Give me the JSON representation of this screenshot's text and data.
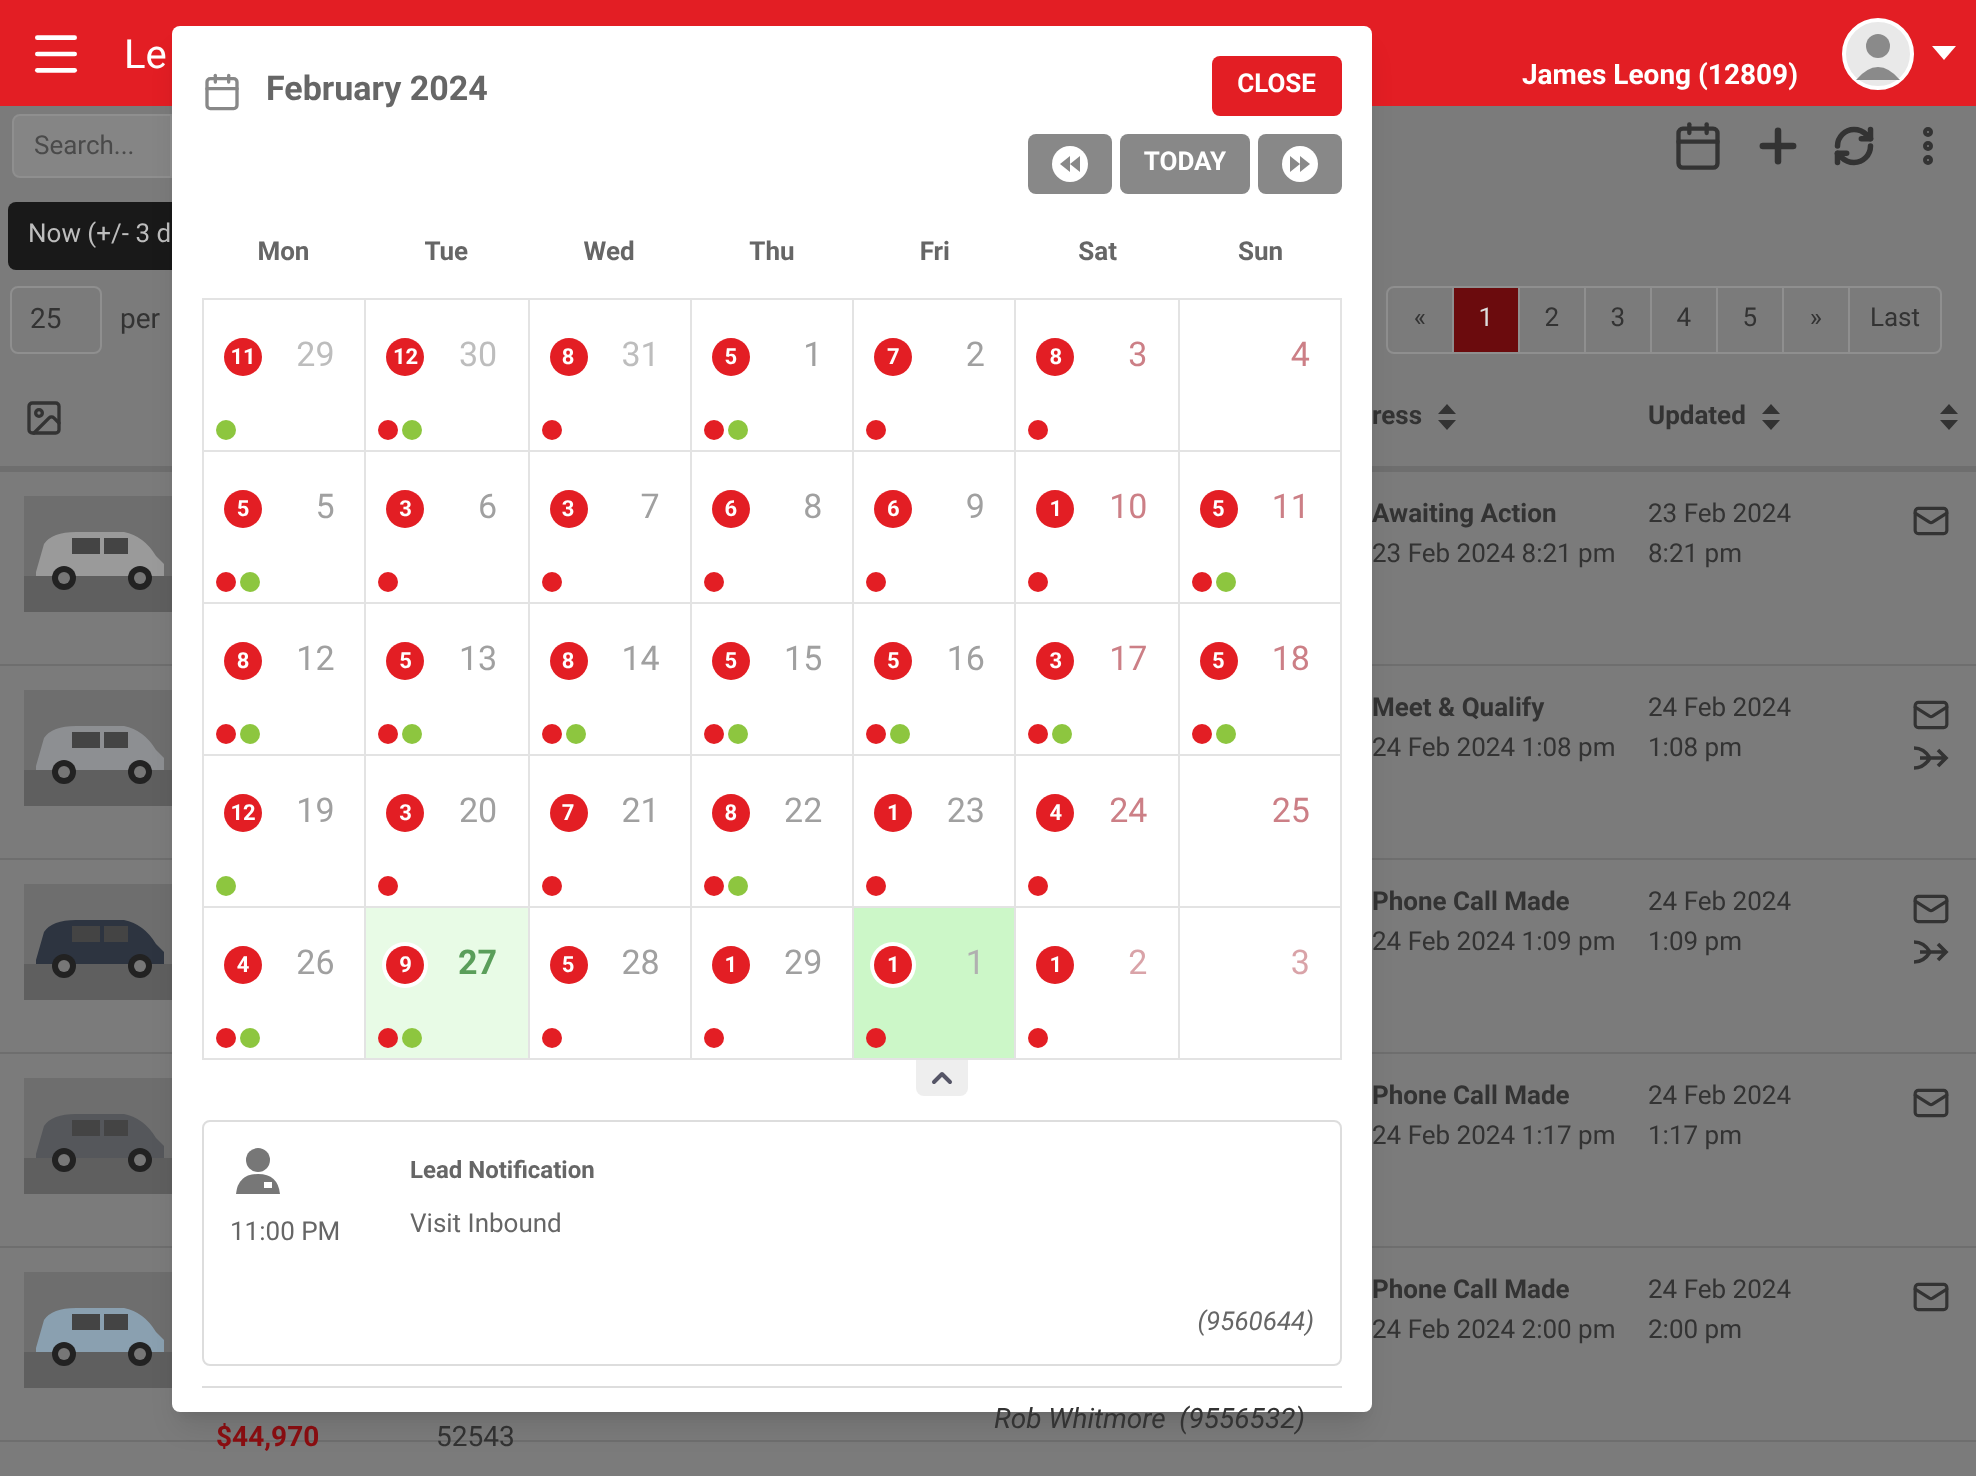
{
  "app": {
    "title": "Le",
    "user": "James Leong (12809)"
  },
  "search": {
    "placeholder": "Search..."
  },
  "filter_button": "Now (+/- 3 d",
  "page_size": {
    "value": "25",
    "label": "per"
  },
  "pagination": [
    {
      "label": "«",
      "selected": false
    },
    {
      "label": "1",
      "selected": true
    },
    {
      "label": "2",
      "selected": false
    },
    {
      "label": "3",
      "selected": false
    },
    {
      "label": "4",
      "selected": false
    },
    {
      "label": "5",
      "selected": false
    },
    {
      "label": "»",
      "selected": false
    },
    {
      "label": "Last",
      "selected": false
    }
  ],
  "table": {
    "columns": [
      "ress",
      "Updated"
    ],
    "rows": [
      {
        "status": "Awaiting Action",
        "status_time": "23 Feb 2024 8:21 pm",
        "updated_date": "23 Feb 2024",
        "updated_time": "8:21 pm",
        "actions": [
          {
            "kind": "mail"
          }
        ]
      },
      {
        "status": "Meet & Qualify",
        "status_time": "24 Feb 2024 1:08 pm",
        "updated_date": "24 Feb 2024",
        "updated_time": "1:08 pm",
        "actions": [
          {
            "kind": "mail"
          },
          {
            "kind": "transfer"
          }
        ]
      },
      {
        "status": "Phone Call Made",
        "status_time": "24 Feb 2024 1:09 pm",
        "updated_date": "24 Feb 2024",
        "updated_time": "1:09 pm",
        "actions": [
          {
            "kind": "mail"
          },
          {
            "kind": "transfer"
          }
        ]
      },
      {
        "status": "Phone Call Made",
        "status_time": "24 Feb 2024 1:17 pm",
        "updated_date": "24 Feb 2024",
        "updated_time": "1:17 pm",
        "actions": [
          {
            "kind": "mail"
          }
        ]
      },
      {
        "status": "Phone Call Made",
        "status_time": "24 Feb 2024 2:00 pm",
        "updated_date": "24 Feb 2024",
        "updated_time": "2:00 pm",
        "actions": [
          {
            "kind": "mail"
          }
        ]
      }
    ],
    "footer": {
      "price": "$44,970",
      "stock": "52543",
      "salesperson": "Rob Whitmore  (9556532)"
    }
  },
  "calendar": {
    "title": "February 2024",
    "close": "CLOSE",
    "today_button": "TODAY",
    "weekdays": [
      "Mon",
      "Tue",
      "Wed",
      "Thu",
      "Fri",
      "Sat",
      "Sun"
    ],
    "weeks": [
      [
        {
          "day": "29",
          "count": "11",
          "kind": "prev",
          "today": false,
          "selected": false,
          "dots": [
            {
              "color": "#8dc63f"
            }
          ]
        },
        {
          "day": "30",
          "count": "12",
          "kind": "prev",
          "today": false,
          "selected": false,
          "dots": [
            {
              "color": "#e31e24"
            },
            {
              "color": "#8dc63f"
            }
          ]
        },
        {
          "day": "31",
          "count": "8",
          "kind": "prev",
          "today": false,
          "selected": false,
          "dots": [
            {
              "color": "#e31e24"
            }
          ]
        },
        {
          "day": "1",
          "count": "5",
          "kind": "current",
          "today": false,
          "selected": false,
          "dots": [
            {
              "color": "#e31e24"
            },
            {
              "color": "#8dc63f"
            }
          ]
        },
        {
          "day": "2",
          "count": "7",
          "kind": "current",
          "today": false,
          "selected": false,
          "dots": [
            {
              "color": "#e31e24"
            }
          ]
        },
        {
          "day": "3",
          "count": "8",
          "kind": "current",
          "today": false,
          "selected": false,
          "dots": [
            {
              "color": "#e31e24"
            }
          ]
        },
        {
          "day": "4",
          "kind": "current",
          "today": false,
          "selected": false
        }
      ],
      [
        {
          "day": "5",
          "count": "5",
          "kind": "current",
          "today": false,
          "selected": false,
          "dots": [
            {
              "color": "#e31e24"
            },
            {
              "color": "#8dc63f"
            }
          ]
        },
        {
          "day": "6",
          "count": "3",
          "kind": "current",
          "today": false,
          "selected": false,
          "dots": [
            {
              "color": "#e31e24"
            }
          ]
        },
        {
          "day": "7",
          "count": "3",
          "kind": "current",
          "today": false,
          "selected": false,
          "dots": [
            {
              "color": "#e31e24"
            }
          ]
        },
        {
          "day": "8",
          "count": "6",
          "kind": "current",
          "today": false,
          "selected": false,
          "dots": [
            {
              "color": "#e31e24"
            }
          ]
        },
        {
          "day": "9",
          "count": "6",
          "kind": "current",
          "today": false,
          "selected": false,
          "dots": [
            {
              "color": "#e31e24"
            }
          ]
        },
        {
          "day": "10",
          "count": "1",
          "kind": "current",
          "today": false,
          "selected": false,
          "dots": [
            {
              "color": "#e31e24"
            }
          ]
        },
        {
          "day": "11",
          "count": "5",
          "kind": "current",
          "today": false,
          "selected": false,
          "dots": [
            {
              "color": "#e31e24"
            },
            {
              "color": "#8dc63f"
            }
          ]
        }
      ],
      [
        {
          "day": "12",
          "count": "8",
          "kind": "current",
          "today": false,
          "selected": false,
          "dots": [
            {
              "color": "#e31e24"
            },
            {
              "color": "#8dc63f"
            }
          ]
        },
        {
          "day": "13",
          "count": "5",
          "kind": "current",
          "today": false,
          "selected": false,
          "dots": [
            {
              "color": "#e31e24"
            },
            {
              "color": "#8dc63f"
            }
          ]
        },
        {
          "day": "14",
          "count": "8",
          "kind": "current",
          "today": false,
          "selected": false,
          "dots": [
            {
              "color": "#e31e24"
            },
            {
              "color": "#8dc63f"
            }
          ]
        },
        {
          "day": "15",
          "count": "5",
          "kind": "current",
          "today": false,
          "selected": false,
          "dots": [
            {
              "color": "#e31e24"
            },
            {
              "color": "#8dc63f"
            }
          ]
        },
        {
          "day": "16",
          "count": "5",
          "kind": "current",
          "today": false,
          "selected": false,
          "dots": [
            {
              "color": "#e31e24"
            },
            {
              "color": "#8dc63f"
            }
          ]
        },
        {
          "day": "17",
          "count": "3",
          "kind": "current",
          "today": false,
          "selected": false,
          "dots": [
            {
              "color": "#e31e24"
            },
            {
              "color": "#8dc63f"
            }
          ]
        },
        {
          "day": "18",
          "count": "5",
          "kind": "current",
          "today": false,
          "selected": false,
          "dots": [
            {
              "color": "#e31e24"
            },
            {
              "color": "#8dc63f"
            }
          ]
        }
      ],
      [
        {
          "day": "19",
          "count": "12",
          "kind": "current",
          "today": false,
          "selected": false,
          "dots": [
            {
              "color": "#8dc63f"
            }
          ]
        },
        {
          "day": "20",
          "count": "3",
          "kind": "current",
          "today": false,
          "selected": false,
          "dots": [
            {
              "color": "#e31e24"
            }
          ]
        },
        {
          "day": "21",
          "count": "7",
          "kind": "current",
          "today": false,
          "selected": false,
          "dots": [
            {
              "color": "#e31e24"
            }
          ]
        },
        {
          "day": "22",
          "count": "8",
          "kind": "current",
          "today": false,
          "selected": false,
          "dots": [
            {
              "color": "#e31e24"
            },
            {
              "color": "#8dc63f"
            }
          ]
        },
        {
          "day": "23",
          "count": "1",
          "kind": "current",
          "today": false,
          "selected": false,
          "dots": [
            {
              "color": "#e31e24"
            }
          ]
        },
        {
          "day": "24",
          "count": "4",
          "kind": "current",
          "today": false,
          "selected": false,
          "dots": [
            {
              "color": "#e31e24"
            }
          ]
        },
        {
          "day": "25",
          "kind": "current",
          "today": false,
          "selected": false
        }
      ],
      [
        {
          "day": "26",
          "count": "4",
          "kind": "current",
          "today": false,
          "selected": false,
          "dots": [
            {
              "color": "#e31e24"
            },
            {
              "color": "#8dc63f"
            }
          ]
        },
        {
          "day": "27",
          "count": "9",
          "kind": "current",
          "today": true,
          "selected": false,
          "dots": [
            {
              "color": "#e31e24"
            },
            {
              "color": "#8dc63f"
            }
          ]
        },
        {
          "day": "28",
          "count": "5",
          "kind": "current",
          "today": false,
          "selected": false,
          "dots": [
            {
              "color": "#e31e24"
            }
          ]
        },
        {
          "day": "29",
          "count": "1",
          "kind": "current",
          "today": false,
          "selected": false,
          "dots": [
            {
              "color": "#e31e24"
            }
          ]
        },
        {
          "day": "1",
          "count": "1",
          "kind": "next",
          "today": false,
          "selected": true,
          "dots": [
            {
              "color": "#e31e24"
            }
          ]
        },
        {
          "day": "2",
          "count": "1",
          "kind": "next",
          "today": false,
          "selected": false,
          "dots": [
            {
              "color": "#e31e24"
            }
          ]
        },
        {
          "day": "3",
          "kind": "next",
          "today": false,
          "selected": false
        }
      ]
    ],
    "notification": {
      "time": "11:00 PM",
      "title": "Lead Notification",
      "source": "Visit Inbound",
      "reference": "(9560644)"
    }
  }
}
